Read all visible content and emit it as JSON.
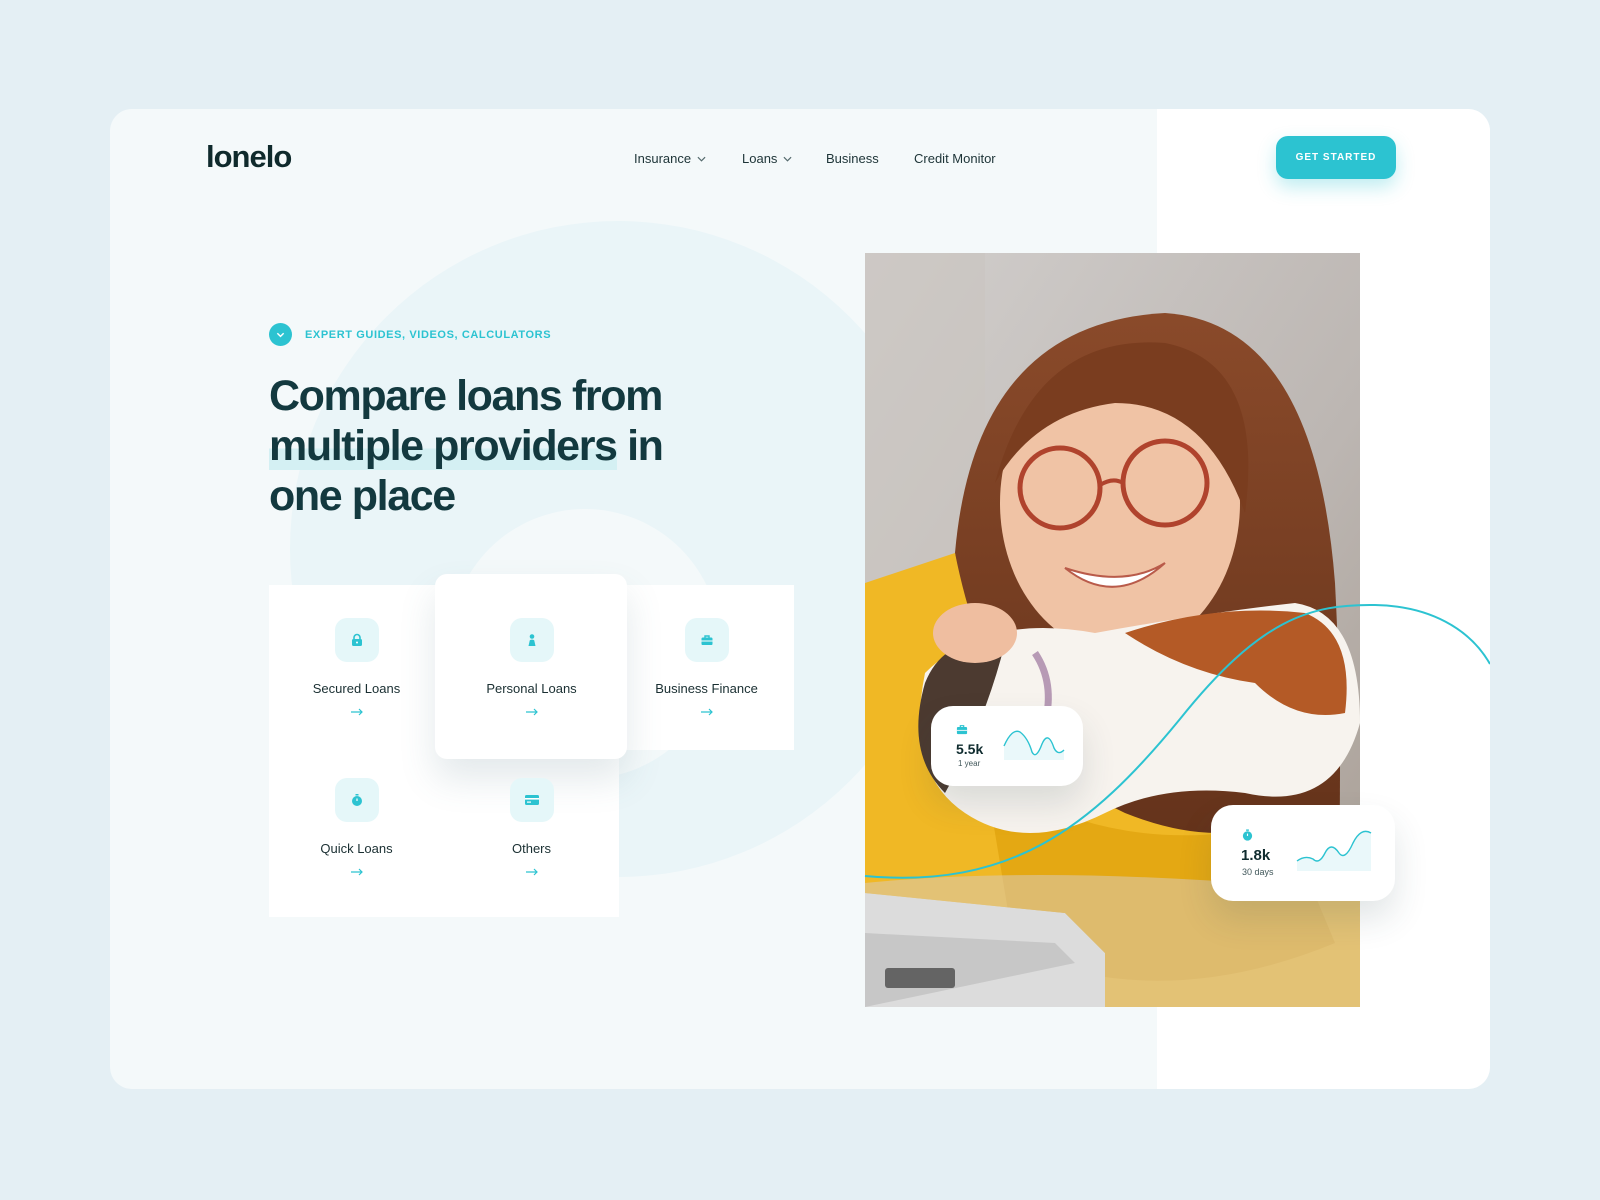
{
  "brand": {
    "logo": "lonelo"
  },
  "nav": {
    "items": [
      {
        "label": "Insurance",
        "dropdown": true
      },
      {
        "label": "Loans",
        "dropdown": true
      },
      {
        "label": "Business",
        "dropdown": false
      },
      {
        "label": "Credit Monitor",
        "dropdown": false
      }
    ],
    "cta": "GET STARTED"
  },
  "hero": {
    "eyebrow": "EXPERT GUIDES, VIDEOS, CALCULATORS",
    "headline": {
      "line1": "Compare loans from",
      "line2_highlight": "multiple providers",
      "line2_rest": " in",
      "line3": "one place"
    }
  },
  "categories": [
    {
      "label": "Secured Loans",
      "icon": "lock-icon"
    },
    {
      "label": "Personal Loans",
      "icon": "person-icon"
    },
    {
      "label": "Business Finance",
      "icon": "briefcase-icon"
    },
    {
      "label": "Quick Loans",
      "icon": "stopwatch-icon"
    },
    {
      "label": "Others",
      "icon": "card-icon"
    }
  ],
  "stats": [
    {
      "value": "5.5k",
      "period": "1 year",
      "icon": "briefcase-icon"
    },
    {
      "value": "1.8k",
      "period": "30 days",
      "icon": "stopwatch-icon"
    }
  ],
  "colors": {
    "accent": "#2cc3d1",
    "headline": "#13393f",
    "page_bg": "#e4eff4",
    "panel_bg": "#f4f9fa",
    "sweater": "#f0b825"
  }
}
